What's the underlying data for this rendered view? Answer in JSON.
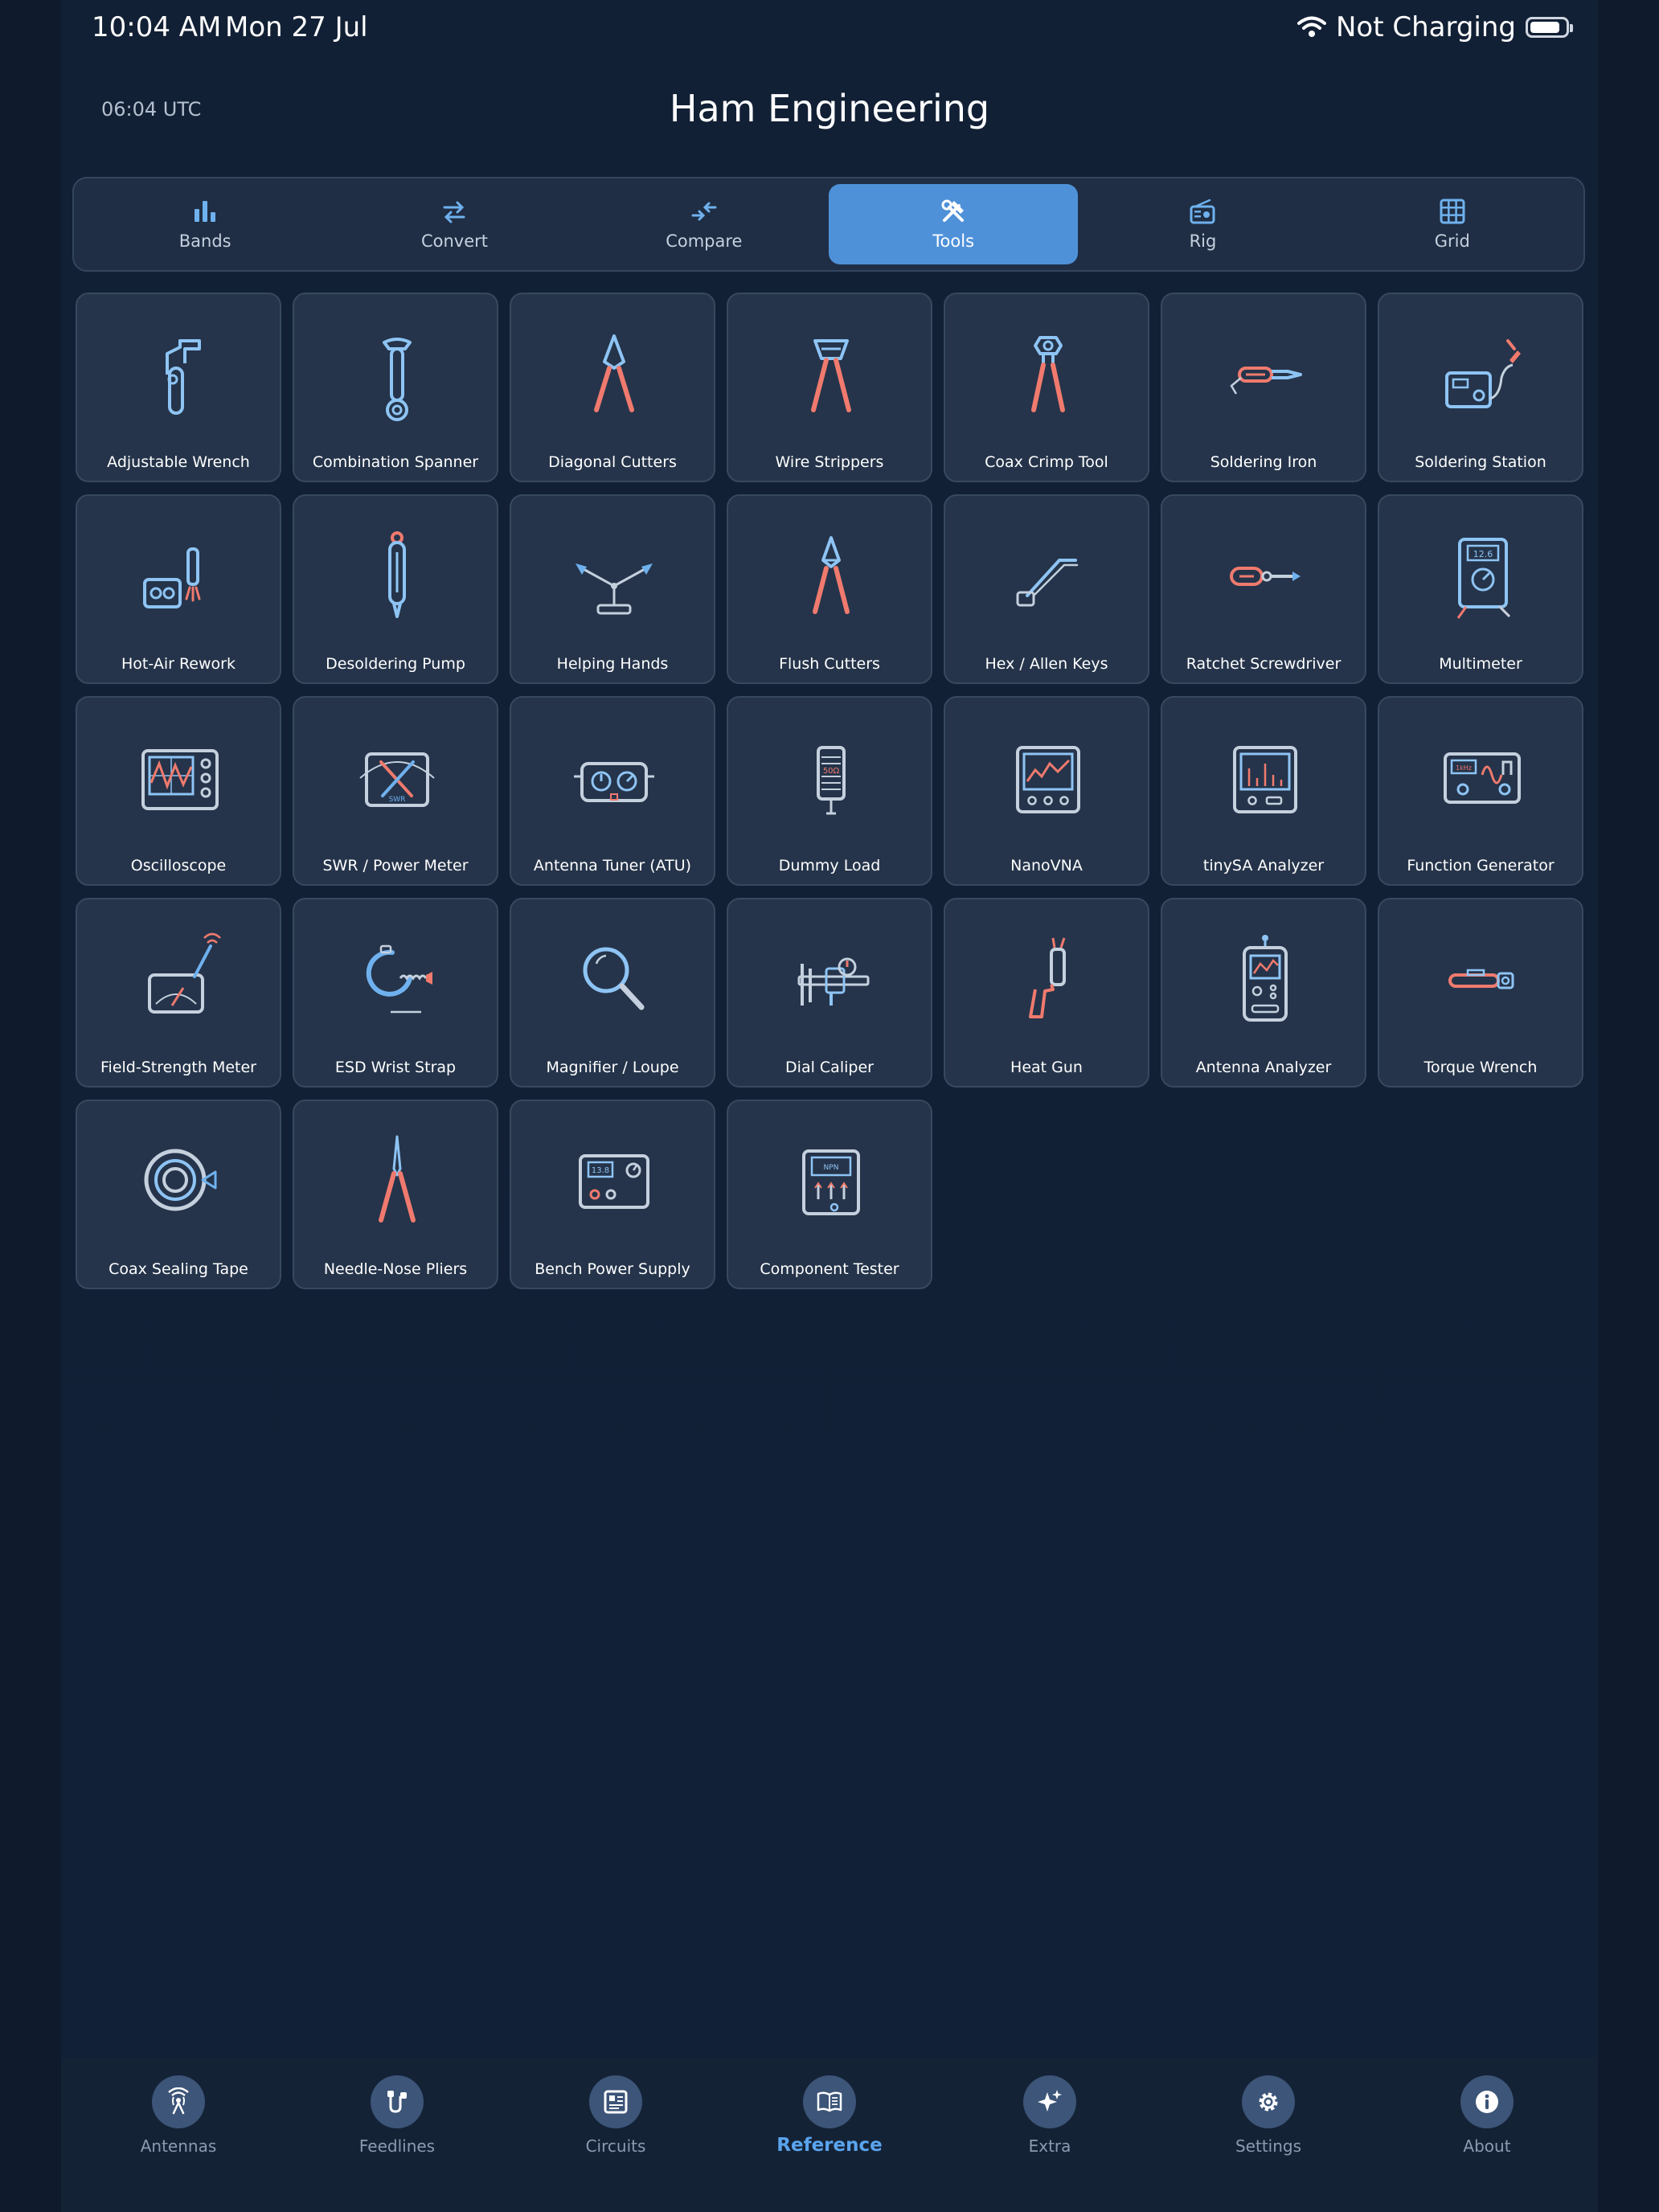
{
  "status": {
    "time": "10:04 AM",
    "date": "Mon 27 Jul",
    "charge": "Not Charging"
  },
  "header": {
    "utc": "06:04 UTC",
    "title": "Ham Engineering"
  },
  "segments": [
    {
      "label": "Bands",
      "icon": "bar-chart-icon"
    },
    {
      "label": "Convert",
      "icon": "swap-arrows-icon"
    },
    {
      "label": "Compare",
      "icon": "compare-arrows-icon"
    },
    {
      "label": "Tools",
      "icon": "hammer-wrench-icon",
      "active": true
    },
    {
      "label": "Rig",
      "icon": "radio-icon"
    },
    {
      "label": "Grid",
      "icon": "grid-icon"
    }
  ],
  "tools": [
    {
      "label": "Adjustable Wrench",
      "icon": "adjustable-wrench-icon"
    },
    {
      "label": "Combination Spanner",
      "icon": "spanner-icon"
    },
    {
      "label": "Diagonal Cutters",
      "icon": "diagonal-cutters-icon"
    },
    {
      "label": "Wire Strippers",
      "icon": "wire-strippers-icon"
    },
    {
      "label": "Coax Crimp Tool",
      "icon": "crimp-tool-icon"
    },
    {
      "label": "Soldering Iron",
      "icon": "soldering-iron-icon"
    },
    {
      "label": "Soldering Station",
      "icon": "soldering-station-icon"
    },
    {
      "label": "Hot-Air Rework",
      "icon": "hot-air-icon"
    },
    {
      "label": "Desoldering Pump",
      "icon": "desoldering-pump-icon"
    },
    {
      "label": "Helping Hands",
      "icon": "helping-hands-icon"
    },
    {
      "label": "Flush Cutters",
      "icon": "flush-cutters-icon"
    },
    {
      "label": "Hex / Allen Keys",
      "icon": "hex-key-icon"
    },
    {
      "label": "Ratchet Screwdriver",
      "icon": "screwdriver-icon"
    },
    {
      "label": "Multimeter",
      "icon": "multimeter-icon"
    },
    {
      "label": "Oscilloscope",
      "icon": "oscilloscope-icon"
    },
    {
      "label": "SWR / Power Meter",
      "icon": "swr-meter-icon"
    },
    {
      "label": "Antenna Tuner (ATU)",
      "icon": "antenna-tuner-icon"
    },
    {
      "label": "Dummy Load",
      "icon": "dummy-load-icon"
    },
    {
      "label": "NanoVNA",
      "icon": "nanovna-icon"
    },
    {
      "label": "tinySA Analyzer",
      "icon": "spectrum-analyzer-icon"
    },
    {
      "label": "Function Generator",
      "icon": "function-generator-icon"
    },
    {
      "label": "Field-Strength Meter",
      "icon": "field-strength-meter-icon"
    },
    {
      "label": "ESD Wrist Strap",
      "icon": "esd-strap-icon"
    },
    {
      "label": "Magnifier / Loupe",
      "icon": "magnifier-icon"
    },
    {
      "label": "Dial Caliper",
      "icon": "caliper-icon"
    },
    {
      "label": "Heat Gun",
      "icon": "heat-gun-icon"
    },
    {
      "label": "Antenna Analyzer",
      "icon": "antenna-analyzer-icon"
    },
    {
      "label": "Torque Wrench",
      "icon": "torque-wrench-icon"
    },
    {
      "label": "Coax Sealing Tape",
      "icon": "tape-icon"
    },
    {
      "label": "Needle-Nose Pliers",
      "icon": "pliers-icon"
    },
    {
      "label": "Bench Power Supply",
      "icon": "power-supply-icon"
    },
    {
      "label": "Component Tester",
      "icon": "component-tester-icon"
    }
  ],
  "icon_text": {
    "dummy_load": "50Ω",
    "multimeter": "12.6",
    "psu": "13.8",
    "func_gen": "1kHz",
    "swr": "SWR",
    "tester": "NPN"
  },
  "tabs": [
    {
      "label": "Antennas",
      "icon": "antenna-icon"
    },
    {
      "label": "Feedlines",
      "icon": "feedline-icon"
    },
    {
      "label": "Circuits",
      "icon": "circuit-board-icon"
    },
    {
      "label": "Reference",
      "icon": "book-icon",
      "active": true
    },
    {
      "label": "Extra",
      "icon": "sparkles-icon"
    },
    {
      "label": "Settings",
      "icon": "gear-icon"
    },
    {
      "label": "About",
      "icon": "info-icon"
    }
  ],
  "colors": {
    "background": "#0f1b2d",
    "tile": "#25344a",
    "accent": "#4f91d9",
    "icon_blue": "#8ec4f4",
    "icon_red": "#f07a6e",
    "tab_active": "#5aa4ee"
  }
}
